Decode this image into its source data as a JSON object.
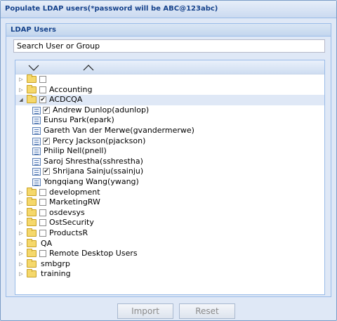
{
  "dialog": {
    "title": "Populate LDAP users(*password will be ABC@123abc)"
  },
  "panel": {
    "title": "LDAP Users"
  },
  "search": {
    "placeholder": "Search User or Group"
  },
  "tree": {
    "rows": [
      {
        "type": "group",
        "label": "",
        "expanded": false,
        "checked": false,
        "has_checkbox": true
      },
      {
        "type": "group",
        "label": "Accounting",
        "expanded": false,
        "checked": false,
        "has_checkbox": true
      },
      {
        "type": "group",
        "label": "ACDCQA",
        "expanded": true,
        "checked": true,
        "has_checkbox": true,
        "selected": true
      },
      {
        "type": "user",
        "label": "Andrew Dunlop(adunlop)",
        "checked": true,
        "has_checkbox": true
      },
      {
        "type": "user",
        "label": "Eunsu Park(epark)",
        "checked": false,
        "has_checkbox": false
      },
      {
        "type": "user",
        "label": "Gareth Van der Merwe(gvandermerwe)",
        "checked": false,
        "has_checkbox": false
      },
      {
        "type": "user",
        "label": "Percy Jackson(pjackson)",
        "checked": true,
        "has_checkbox": true
      },
      {
        "type": "user",
        "label": "Philip Nell(pnell)",
        "checked": false,
        "has_checkbox": false
      },
      {
        "type": "user",
        "label": "Saroj Shrestha(sshrestha)",
        "checked": false,
        "has_checkbox": false
      },
      {
        "type": "user",
        "label": "Shrijana Sainju(ssainju)",
        "checked": true,
        "has_checkbox": true
      },
      {
        "type": "user",
        "label": "Yongqiang Wang(ywang)",
        "checked": false,
        "has_checkbox": false
      },
      {
        "type": "group",
        "label": "development",
        "expanded": false,
        "checked": false,
        "has_checkbox": true
      },
      {
        "type": "group",
        "label": "MarketingRW",
        "expanded": false,
        "checked": false,
        "has_checkbox": true
      },
      {
        "type": "group",
        "label": "osdevsys",
        "expanded": false,
        "checked": false,
        "has_checkbox": true
      },
      {
        "type": "group",
        "label": "OstSecurity",
        "expanded": false,
        "checked": false,
        "has_checkbox": true
      },
      {
        "type": "group",
        "label": "ProductsR",
        "expanded": false,
        "checked": false,
        "has_checkbox": true
      },
      {
        "type": "group",
        "label": "QA",
        "expanded": false,
        "checked": false,
        "has_checkbox": false
      },
      {
        "type": "group",
        "label": "Remote Desktop Users",
        "expanded": false,
        "checked": false,
        "has_checkbox": true
      },
      {
        "type": "group",
        "label": "smbgrp",
        "expanded": false,
        "checked": false,
        "has_checkbox": false
      },
      {
        "type": "group",
        "label": "training",
        "expanded": false,
        "checked": false,
        "has_checkbox": false
      }
    ]
  },
  "buttons": {
    "import_label": "Import",
    "reset_label": "Reset"
  },
  "colors": {
    "title_text": "#15428b",
    "panel_bg": "#dfe8f6",
    "border": "#99bbe8",
    "folder": "#f5d86b"
  }
}
